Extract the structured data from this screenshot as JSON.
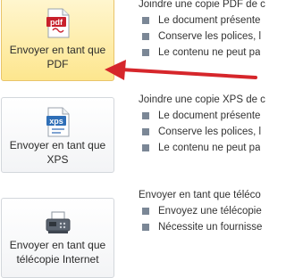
{
  "options": [
    {
      "button_label": "Envoyer en tant que\nPDF",
      "icon": "pdf-file-icon",
      "icon_text": "pdf",
      "title": "Joindre une copie PDF de c",
      "bullets": [
        "Le document présente",
        "Conserve les polices, l",
        "Le contenu ne peut pa"
      ]
    },
    {
      "button_label": "Envoyer en tant que\nXPS",
      "icon": "xps-file-icon",
      "icon_text": "xps",
      "title": "Joindre une copie XPS de c",
      "bullets": [
        "Le document présente",
        "Conserve les polices, l",
        "Le contenu ne peut pa"
      ]
    },
    {
      "button_label": "Envoyer en tant que\ntélécopie Internet",
      "icon": "fax-machine-icon",
      "title": "Envoyer en tant que téléco",
      "bullets": [
        "Envoyez une télécopie",
        "Nécessite un fournisse"
      ]
    }
  ],
  "colors": {
    "selected_bg": "#fde68e",
    "arrow": "#d6262b",
    "pdf_red": "#c8202c",
    "xps_blue": "#2f6fb7"
  }
}
